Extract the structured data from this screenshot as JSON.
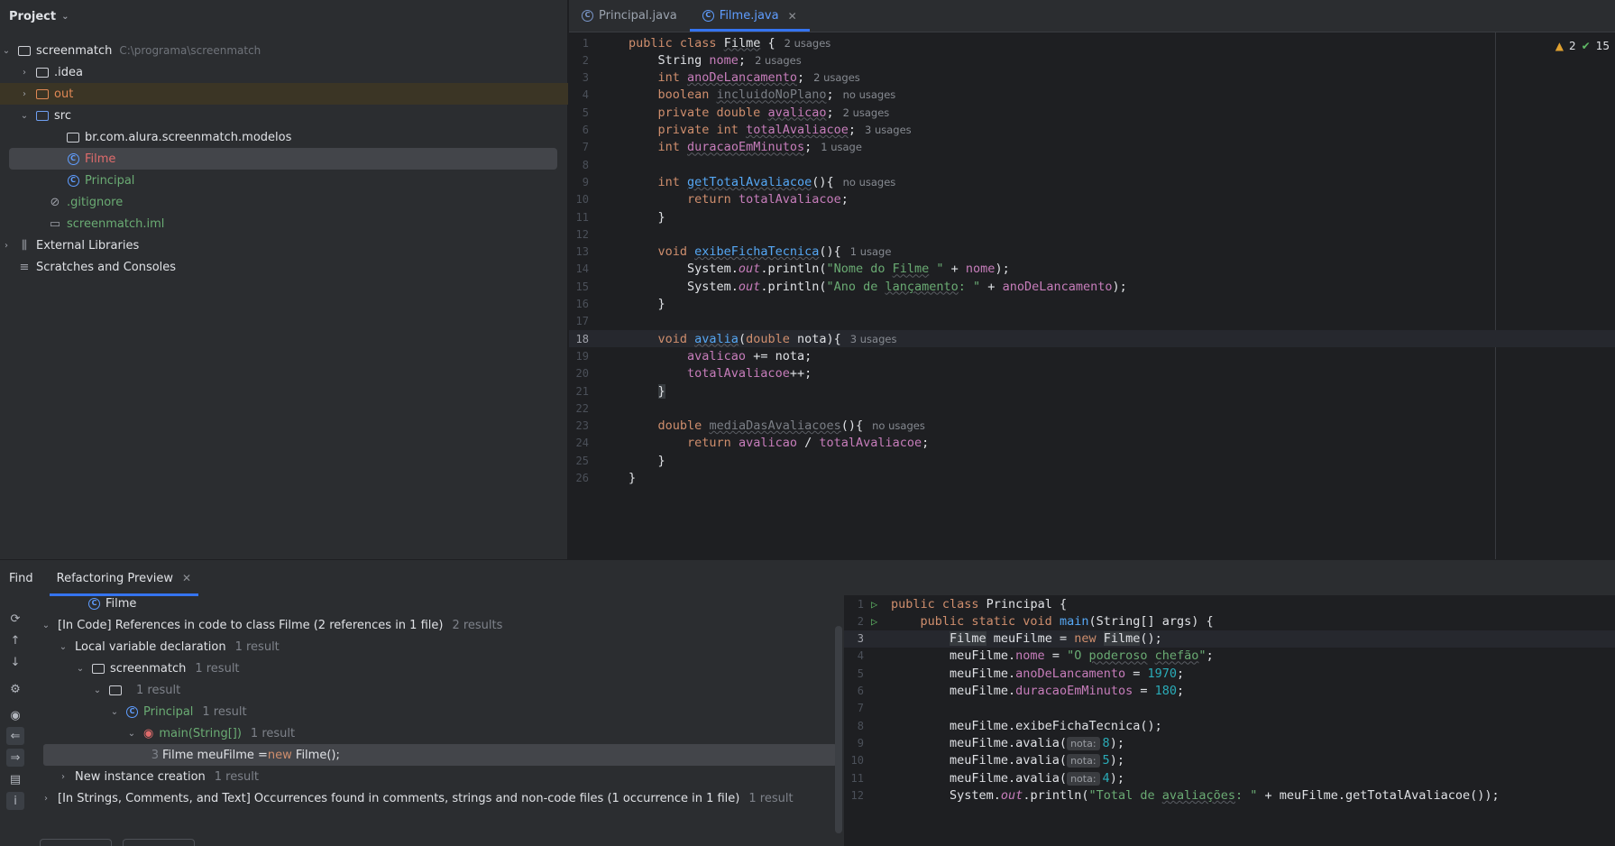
{
  "project": {
    "title": "Project",
    "tree": [
      {
        "label": "screenmatch",
        "hint": "C:\\programa\\screenmatch",
        "icon": "module-folder-icon",
        "color": "#dfe1e5"
      },
      {
        "label": ".idea",
        "icon": "folder-icon",
        "color": "#dfe1e5"
      },
      {
        "label": "out",
        "icon": "excluded-folder-icon",
        "color": "#e08855"
      },
      {
        "label": "src",
        "icon": "source-folder-icon",
        "color": "#dfe1e5"
      },
      {
        "label": "br.com.alura.screenmatch.modelos",
        "icon": "package-icon",
        "color": "#dfe1e5"
      },
      {
        "label": "Filme",
        "icon": "class-icon",
        "color": "#e06c6c"
      },
      {
        "label": "Principal",
        "icon": "class-runnable-icon",
        "color": "#6aab73"
      },
      {
        "label": ".gitignore",
        "icon": "ignored-file-icon",
        "color": "#6aab73"
      },
      {
        "label": "screenmatch.iml",
        "icon": "iml-file-icon",
        "color": "#6aab73"
      },
      {
        "label": "External Libraries",
        "icon": "library-icon",
        "color": "#dfe1e5"
      },
      {
        "label": "Scratches and Consoles",
        "icon": "scratches-icon",
        "color": "#dfe1e5"
      }
    ]
  },
  "editor": {
    "tabs": [
      {
        "label": "Principal.java",
        "active": false
      },
      {
        "label": "Filme.java",
        "active": true
      }
    ],
    "inspection": {
      "warnings": "2",
      "ok": "15"
    },
    "lines": [
      {
        "n": "1",
        "html": "<span class='kw'>public class</span> <span class='uline'>Filme</span> {<span class='usage'>2 usages</span>"
      },
      {
        "n": "2",
        "html": "    String <span class='fld'>nome</span>;<span class='usage'>2 usages</span>"
      },
      {
        "n": "3",
        "html": "    <span class='kw'>int</span> <span class='fld uline'>anoDeLancamento</span>;<span class='usage'>2 usages</span>"
      },
      {
        "n": "4",
        "html": "    <span class='kw'>boolean</span> <span class='gry uline'>incluidoNoPlano</span>;<span class='usage'>no usages</span>"
      },
      {
        "n": "5",
        "html": "    <span class='kw'>private double</span> <span class='fld uline'>avalicao</span>;<span class='usage'>2 usages</span>"
      },
      {
        "n": "6",
        "html": "    <span class='kw'>private int</span> <span class='fld uline'>totalAvaliacoe</span>;<span class='usage'>3 usages</span>"
      },
      {
        "n": "7",
        "html": "    <span class='kw'>int</span> <span class='fld uline'>duracaoEmMinutos</span>;<span class='usage'>1 usage</span>"
      },
      {
        "n": "8",
        "html": ""
      },
      {
        "n": "9",
        "html": "    <span class='kw'>int</span> <span class='fn uline'>getTotalAvaliacoe</span>(){<span class='usage'>no usages</span>"
      },
      {
        "n": "10",
        "html": "        <span class='kw'>return</span> <span class='fld'>totalAvaliacoe</span>;"
      },
      {
        "n": "11",
        "html": "    }"
      },
      {
        "n": "12",
        "html": ""
      },
      {
        "n": "13",
        "html": "    <span class='kw'>void</span> <span class='fn uline'>exibeFichaTecnica</span>(){<span class='usage'>1 usage</span>"
      },
      {
        "n": "14",
        "html": "        System.<span class='fld it'>out</span>.println(<span class='str'>\"Nome do <span class='uline'>Filme</span> \"</span> + <span class='fld'>nome</span>);"
      },
      {
        "n": "15",
        "html": "        System.<span class='fld it'>out</span>.println(<span class='str'>\"Ano de <span class='uline'>lançamento</span>: \"</span> + <span class='fld'>anoDeLancamento</span>);"
      },
      {
        "n": "16",
        "html": "    }"
      },
      {
        "n": "17",
        "html": ""
      },
      {
        "n": "18",
        "html": "    <span class='kw'>void</span> <span class='fn uline'>avalia</span>(<span class='kw'>double</span> nota){<span class='usage'>3 usages</span>"
      },
      {
        "n": "19",
        "html": "        <span class='fld'>avalicao</span> += nota;"
      },
      {
        "n": "20",
        "html": "        <span class='fld'>totalAvaliacoe</span>++;"
      },
      {
        "n": "21",
        "html": "    <span class='hl'>}</span>"
      },
      {
        "n": "22",
        "html": ""
      },
      {
        "n": "23",
        "html": "    <span class='kw'>double</span> <span class='gry uline'>mediaDasAvaliacoes</span>(){<span class='usage'>no usages</span>"
      },
      {
        "n": "24",
        "html": "        <span class='kw'>return</span> <span class='fld'>avalicao</span> / <span class='fld'>totalAvaliacoe</span>;"
      },
      {
        "n": "25",
        "html": "    }"
      },
      {
        "n": "26",
        "html": "}"
      }
    ],
    "current_line": "18"
  },
  "bottom": {
    "tabs": [
      {
        "label": "Find"
      },
      {
        "label": "Refactoring Preview"
      }
    ],
    "results": [
      {
        "label": "Filme",
        "count": "",
        "indent": 0,
        "chev": "",
        "icon": "class-icon"
      },
      {
        "label": "[In Code] References in code to class Filme (2 references in 1 file)",
        "count": "2 results",
        "indent": 0,
        "chev": "⌄"
      },
      {
        "label": "Local variable declaration",
        "count": "1 result",
        "indent": 1,
        "chev": "⌄"
      },
      {
        "label": "screenmatch",
        "count": "1 result",
        "indent": 2,
        "chev": "⌄",
        "icon": "module-folder-icon"
      },
      {
        "label": "",
        "count": "1 result",
        "indent": 3,
        "chev": "⌄",
        "icon": "package-icon"
      },
      {
        "label": "Principal",
        "count": "1 result",
        "indent": 4,
        "chev": "⌄",
        "icon": "class-runnable-icon",
        "green": true
      },
      {
        "label": "main(String[])",
        "count": "1 result",
        "indent": 5,
        "chev": "⌄",
        "icon": "method-icon",
        "green": true
      },
      {
        "label": "",
        "count": "",
        "indent": 6,
        "chev": "",
        "code": true
      },
      {
        "label": "New instance creation",
        "count": "1 result",
        "indent": 1,
        "chev": "›"
      },
      {
        "label": "[In Strings, Comments, and Text] Occurrences found in comments, strings and non-code files  (1 occurrence in 1 file)",
        "count": "1 result",
        "indent": 0,
        "chev": "›"
      }
    ],
    "selected_code": {
      "line": "3",
      "before": "Filme meuFilme = ",
      "kw": "new",
      "after": " Filme();"
    },
    "preview": [
      {
        "n": "1",
        "run": true,
        "html": "<span class='kw'>public class</span> Principal {"
      },
      {
        "n": "2",
        "run": true,
        "html": "    <span class='kw'>public static void</span> <span class='fn'>main</span>(String[] args) {"
      },
      {
        "n": "3",
        "run": false,
        "html": "        <span class='hl'>Filme</span> meuFilme = <span class='kw'>new</span> <span class='hl'>Filme</span>();"
      },
      {
        "n": "4",
        "run": false,
        "html": "        meuFilme.<span class='fld'>nome</span> = <span class='str'>\"O <span class='uline'>poderoso</span> <span class='uline'>chefão</span>\"</span>;"
      },
      {
        "n": "5",
        "run": false,
        "html": "        meuFilme.<span class='fld'>anoDeLancamento</span> = <span class='num'>1970</span>;"
      },
      {
        "n": "6",
        "run": false,
        "html": "        meuFilme.<span class='fld'>duracaoEmMinutos</span> = <span class='num'>180</span>;"
      },
      {
        "n": "7",
        "run": false,
        "html": ""
      },
      {
        "n": "8",
        "run": false,
        "html": "        meuFilme.exibeFichaTecnica();"
      },
      {
        "n": "9",
        "run": false,
        "html": "        meuFilme.avalia(<span class='inlay'>nota:</span><span class='num'>8</span>);"
      },
      {
        "n": "10",
        "run": false,
        "html": "        meuFilme.avalia(<span class='inlay'>nota:</span><span class='num'>5</span>);"
      },
      {
        "n": "11",
        "run": false,
        "html": "        meuFilme.avalia(<span class='inlay'>nota:</span><span class='num'>4</span>);"
      },
      {
        "n": "12",
        "run": false,
        "html": "        System.<span class='fld it'>out</span>.println(<span class='str'>\"Total de <span class='uline'>avaliações</span>: \"</span> + meuFilme.getTotalAvaliacoe());"
      }
    ],
    "preview_current": "3"
  }
}
